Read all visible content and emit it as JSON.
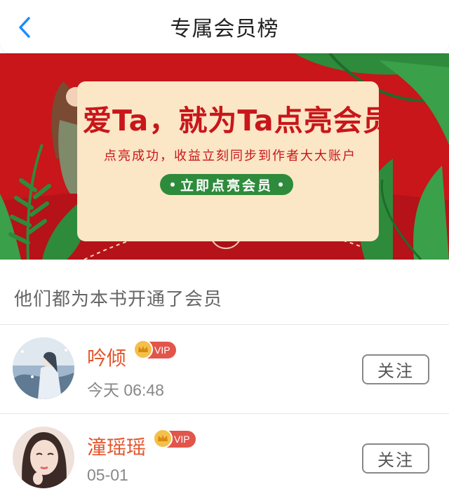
{
  "header": {
    "title": "专属会员榜",
    "back_icon": "chevron-left-icon",
    "accent_color": "#1a8cff"
  },
  "banner": {
    "headline": "爱Ta，就为Ta点亮会员",
    "subtitle": "点亮成功，收益立刻同步到作者大大账户",
    "cta_label": "立即点亮会员",
    "background_color": "#c8161a",
    "card_color": "#fbe6c6",
    "cta_color": "#2e8b3c"
  },
  "section": {
    "title": "他们都为本书开通了会员"
  },
  "members": [
    {
      "name": "吟倾",
      "badge": "VIP",
      "time": "今天 06:48",
      "follow_label": "关注"
    },
    {
      "name": "潼瑶瑶",
      "badge": "VIP",
      "time": "05-01",
      "follow_label": "关注"
    }
  ],
  "colors": {
    "name": "#e2552b",
    "vip_badge": "#e2554b",
    "vip_crown": "#f4c04a"
  }
}
